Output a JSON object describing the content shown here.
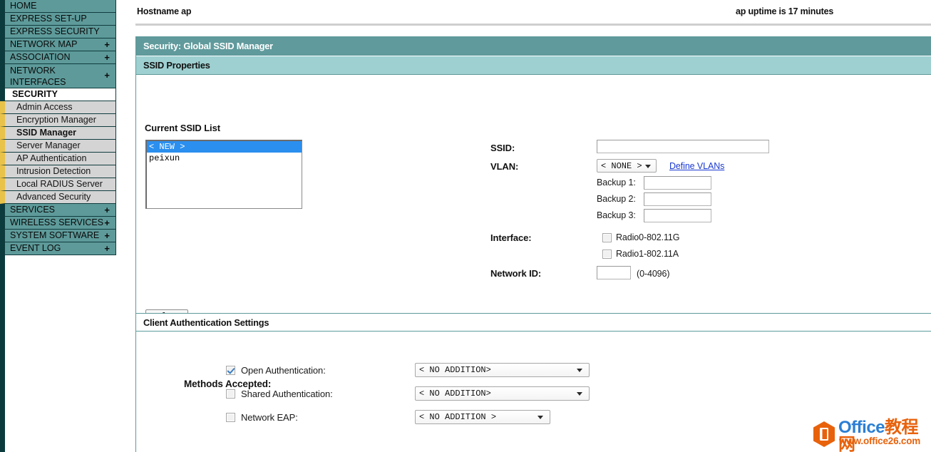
{
  "header": {
    "hostname_label": "Hostname  ap",
    "uptime_label": "ap uptime is 17 minutes"
  },
  "sidebar": {
    "top_items": [
      {
        "label": "HOME",
        "expand": ""
      },
      {
        "label": "EXPRESS SET-UP",
        "expand": ""
      },
      {
        "label": "EXPRESS SECURITY",
        "expand": ""
      },
      {
        "label": "NETWORK MAP",
        "expand": "+"
      },
      {
        "label": "ASSOCIATION",
        "expand": "+"
      },
      {
        "label": "NETWORK INTERFACES",
        "expand": "+"
      }
    ],
    "active_item": "SECURITY",
    "sub_items": [
      {
        "label": "Admin Access"
      },
      {
        "label": "Encryption Manager"
      },
      {
        "label": "SSID Manager"
      },
      {
        "label": "Server Manager"
      },
      {
        "label": "AP Authentication"
      },
      {
        "label": "Intrusion Detection"
      },
      {
        "label": "Local RADIUS Server"
      },
      {
        "label": "Advanced Security"
      }
    ],
    "current_sub": "SSID Manager",
    "bottom_items": [
      {
        "label": "SERVICES",
        "expand": "+"
      },
      {
        "label": "WIRELESS SERVICES",
        "expand": "+"
      },
      {
        "label": "SYSTEM SOFTWARE",
        "expand": "+"
      },
      {
        "label": "EVENT LOG",
        "expand": "+"
      }
    ]
  },
  "panel": {
    "title": "Security: Global SSID Manager",
    "subtitle": "SSID Properties",
    "section2_title": "Client Authentication Settings"
  },
  "ssid_properties": {
    "list_label": "Current SSID List",
    "list_options": [
      {
        "text": "< NEW >",
        "selected": true
      },
      {
        "text": "peixun",
        "selected": false
      }
    ],
    "delete_button": "Delete",
    "ssid_label": "SSID:",
    "ssid_value": "",
    "vlan_label": "VLAN:",
    "vlan_value": "< NONE >",
    "define_vlans_link": "Define VLANs",
    "backup1_label": "Backup 1:",
    "backup1_value": "",
    "backup2_label": "Backup 2:",
    "backup2_value": "",
    "backup3_label": "Backup 3:",
    "backup3_value": "",
    "interface_label": "Interface:",
    "interfaces": [
      {
        "label": "Radio0-802.11G",
        "checked": false
      },
      {
        "label": "Radio1-802.11A",
        "checked": false
      }
    ],
    "network_id_label": "Network ID:",
    "network_id_value": "",
    "network_id_hint": "(0-4096)"
  },
  "client_auth": {
    "methods_label": "Methods Accepted:",
    "rows": [
      {
        "label": "Open Authentication:",
        "checked": true,
        "value": "< NO ADDITION>"
      },
      {
        "label": "Shared Authentication:",
        "checked": false,
        "value": "< NO ADDITION>"
      },
      {
        "label": "Network EAP:",
        "checked": false,
        "value": "< NO ADDITION >"
      }
    ]
  },
  "watermark": {
    "brand_en": "Office",
    "brand_cn": "教程网",
    "url": "www.office26.com"
  },
  "colors": {
    "sidebar_teal": "#5e9a9a",
    "rail_dark": "#0c3b3d",
    "submenu_gray": "#d4d4d4",
    "accent_yellow": "#e9c24a",
    "panel_header": "#609a9c",
    "panel_subheader": "#9fd0d1",
    "select_blue": "#2b8fef",
    "link_blue": "#1a39d0",
    "watermark_orange": "#e8620c",
    "watermark_blue": "#2b7fd4"
  }
}
